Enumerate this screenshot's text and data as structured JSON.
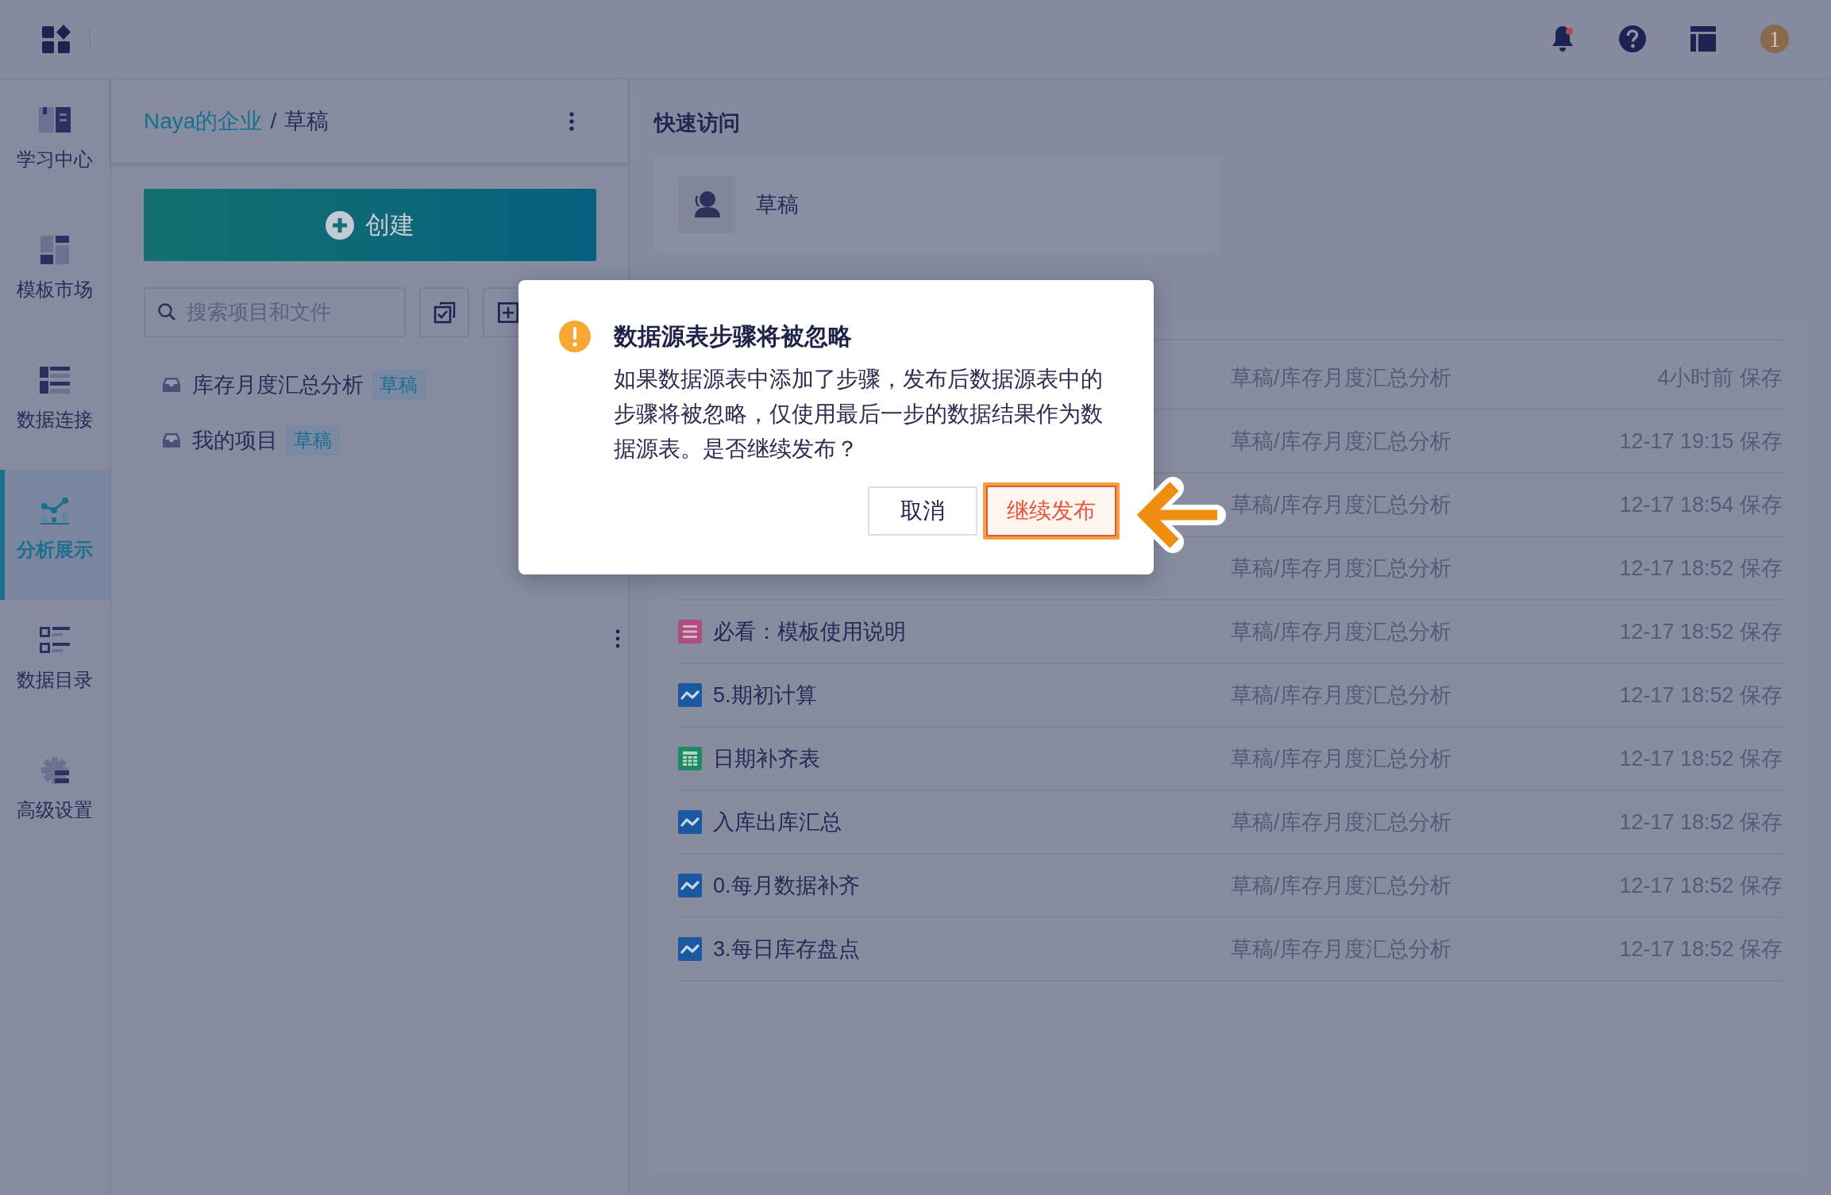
{
  "header": {
    "notifications": {
      "unread": true
    },
    "avatar": {
      "label": "1"
    }
  },
  "nav": [
    {
      "label": "学习中心",
      "selected": false
    },
    {
      "label": "模板市场",
      "selected": false
    },
    {
      "label": "数据连接",
      "selected": false
    },
    {
      "label": "分析展示",
      "selected": true
    },
    {
      "label": "数据目录",
      "selected": false
    },
    {
      "label": "高级设置",
      "selected": false
    }
  ],
  "breadcrumb": {
    "items": [
      {
        "label": "Naya的企业",
        "kind": "link"
      },
      {
        "label": "草稿",
        "kind": "current"
      }
    ],
    "separator": "/"
  },
  "create_button": {
    "label": "创建"
  },
  "search": {
    "placeholder": "搜索项目和文件"
  },
  "projects": [
    {
      "label": "库存月度汇总分析",
      "tag": "草稿"
    },
    {
      "label": "我的项目",
      "tag": "草稿"
    }
  ],
  "quick_access": {
    "title": "快速访问",
    "items": [
      {
        "label": "草稿"
      }
    ]
  },
  "files": [
    {
      "path": "草稿/库存月度汇总分析",
      "saved": "4小时前 保存"
    },
    {
      "path": "草稿/库存月度汇总分析",
      "saved": "12-17 19:15 保存"
    },
    {
      "path": "草稿/库存月度汇总分析",
      "saved": "12-17 18:54 保存"
    },
    {
      "path": "草稿/库存月度汇总分析",
      "saved": "12-17 18:52 保存"
    },
    {
      "name": "必看：模板使用说明",
      "kind": "doc",
      "path": "草稿/库存月度汇总分析",
      "saved": "12-17 18:52 保存"
    },
    {
      "name": "5.期初计算",
      "kind": "flow",
      "path": "草稿/库存月度汇总分析",
      "saved": "12-17 18:52 保存"
    },
    {
      "name": "日期补齐表",
      "kind": "table",
      "path": "草稿/库存月度汇总分析",
      "saved": "12-17 18:52 保存"
    },
    {
      "name": "入库出库汇总",
      "kind": "flow",
      "path": "草稿/库存月度汇总分析",
      "saved": "12-17 18:52 保存"
    },
    {
      "name": "0.每月数据补齐",
      "kind": "flow",
      "path": "草稿/库存月度汇总分析",
      "saved": "12-17 18:52 保存"
    },
    {
      "name": "3.每日库存盘点",
      "kind": "flow",
      "path": "草稿/库存月度汇总分析",
      "saved": "12-17 18:52 保存"
    }
  ],
  "dialog": {
    "title": "数据源表步骤将被忽略",
    "message": "如果数据源表中添加了步骤，发布后数据源表中的步骤将被忽略，仅使用最后一步的数据结果作为数据源表。是否继续发布？",
    "buttons": [
      {
        "label": "取消",
        "kind": "default",
        "highlighted": false
      },
      {
        "label": "继续发布",
        "kind": "primary",
        "highlighted": true
      }
    ]
  }
}
